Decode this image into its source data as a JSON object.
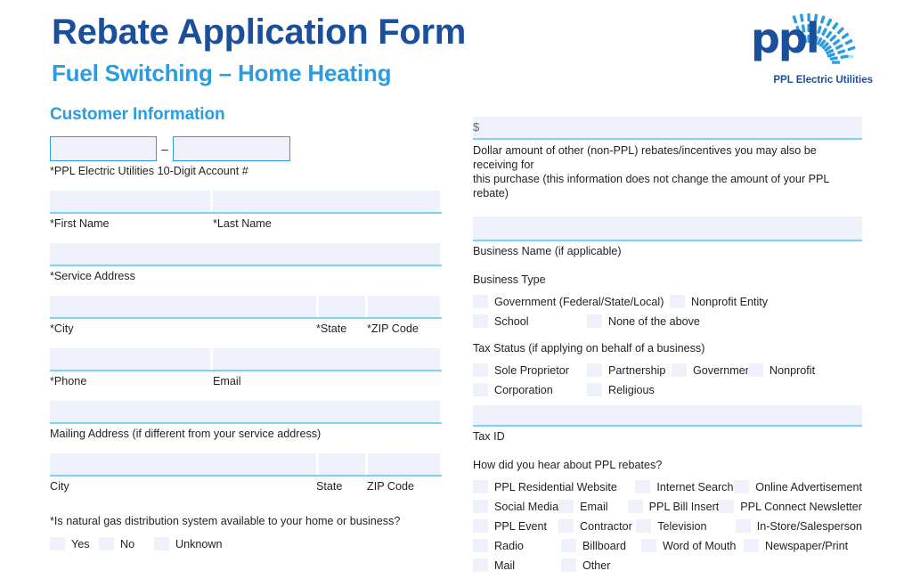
{
  "header": {
    "title": "Rebate Application Form",
    "subtitle": "Fuel Switching – Home Heating",
    "title_color": "#1a4f9c",
    "subtitle_color": "#2b9ce0"
  },
  "logo": {
    "wordmark": "ppl",
    "trademark": "™",
    "caption": "PPL Electric Utilities"
  },
  "left": {
    "section_heading": "Customer Information",
    "account": {
      "separator": "–",
      "label": "*PPL Electric Utilities 10-Digit Account #",
      "part1_value": "",
      "part2_value": ""
    },
    "name": {
      "first_label": "*First Name",
      "last_label": "*Last Name",
      "first_value": "",
      "last_value": ""
    },
    "service_address": {
      "label": "*Service Address",
      "value": ""
    },
    "service_city": {
      "city_label": "*City",
      "state_label": "*State",
      "zip_label": "*ZIP Code",
      "city_value": "",
      "state_value": "",
      "zip_value": ""
    },
    "contact": {
      "phone_label": "*Phone",
      "email_label": "Email",
      "phone_value": "",
      "email_value": ""
    },
    "mailing_address": {
      "label": "Mailing Address (if different from your service address)",
      "value": ""
    },
    "mailing_city": {
      "city_label": "City",
      "state_label": "State",
      "zip_label": "ZIP Code",
      "city_value": "",
      "state_value": "",
      "zip_value": ""
    },
    "gas_question": {
      "label": "*Is natural gas distribution system available to your home or business?",
      "options": [
        "Yes",
        "No",
        "Unknown"
      ]
    }
  },
  "right": {
    "other_rebate": {
      "currency_symbol": "$",
      "value": "",
      "description_line1": "Dollar amount of other (non-PPL) rebates/incentives you may also be receiving for",
      "description_line2": "this purchase (this information does not change the amount of your PPL rebate)"
    },
    "business_name": {
      "label": "Business Name (if applicable)",
      "value": ""
    },
    "business_type": {
      "label": "Business Type",
      "options_row1": [
        "Government (Federal/State/Local)",
        "Nonprofit Entity"
      ],
      "options_row2": [
        "School",
        "None of the above"
      ]
    },
    "tax_status": {
      "label": "Tax Status (if applying on behalf of a business)",
      "options_row1": [
        "Sole Proprietor",
        "Partnership",
        "Government",
        "Nonprofit"
      ],
      "options_row2": [
        "Corporation",
        "Religious"
      ]
    },
    "tax_id": {
      "label": "Tax ID",
      "value": ""
    },
    "referral": {
      "label": "How did you hear about PPL rebates?",
      "rows": [
        [
          "PPL Residential Website",
          "",
          "Internet Search",
          "Online Advertisement"
        ],
        [
          "Social Media",
          "Email",
          "PPL Bill Insert",
          "PPL Connect Newsletter"
        ],
        [
          "PPL Event",
          "Contractor",
          "Television",
          "In-Store/Salesperson"
        ],
        [
          "Radio",
          "Billboard",
          "Word of Mouth",
          "Newspaper/Print"
        ],
        [
          "Mail",
          "Other",
          "",
          ""
        ]
      ]
    }
  }
}
